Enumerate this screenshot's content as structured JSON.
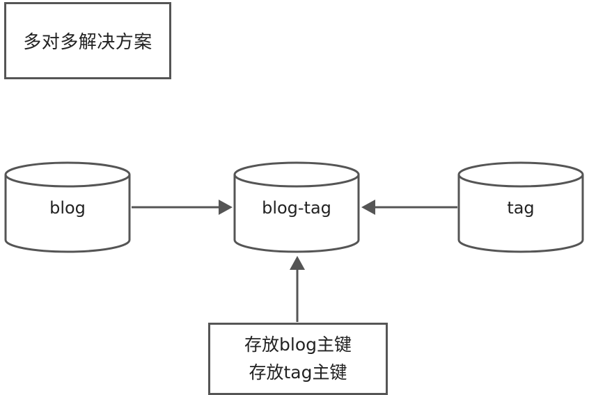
{
  "title": "多对多解决方案",
  "tables": {
    "blog": "blog",
    "blog_tag": "blog-tag",
    "tag": "tag"
  },
  "note": {
    "line1": "存放blog主键",
    "line2": "存放tag主键"
  }
}
